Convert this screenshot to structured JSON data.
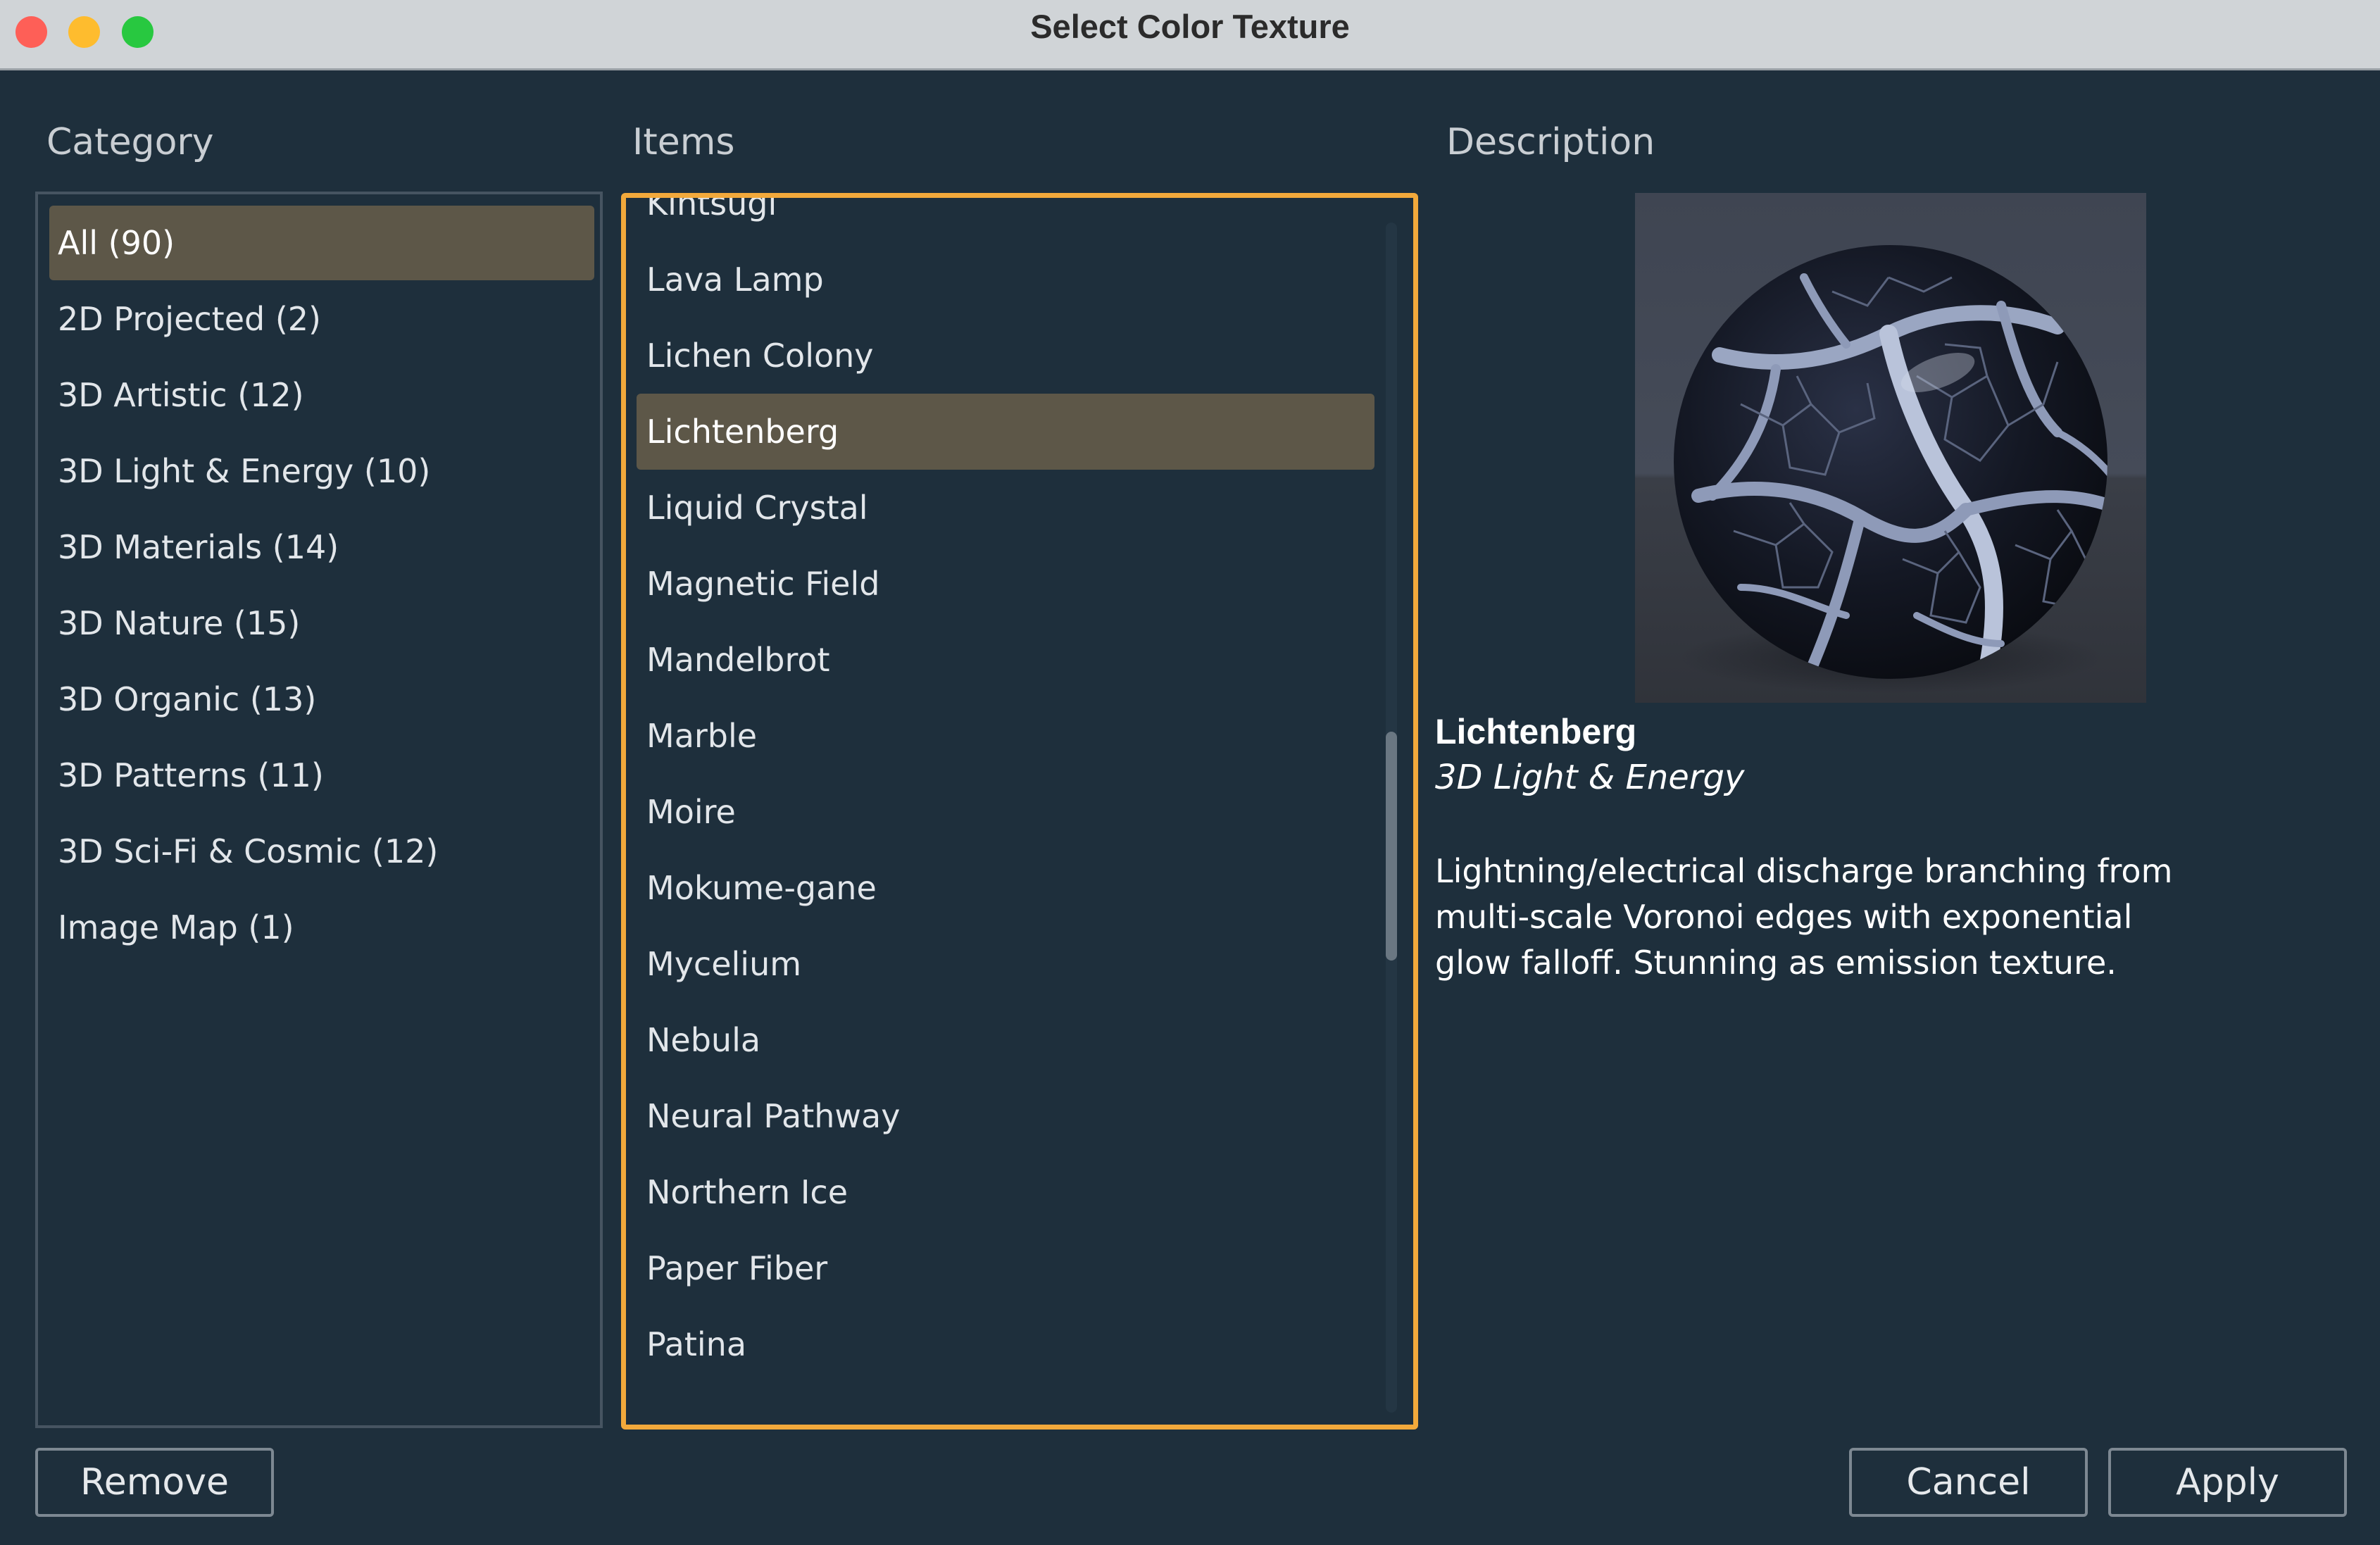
{
  "window": {
    "title": "Select Color Texture"
  },
  "headers": {
    "category": "Category",
    "items": "Items",
    "description": "Description"
  },
  "categories": [
    {
      "label": "All (90)",
      "selected": true
    },
    {
      "label": "2D Projected (2)"
    },
    {
      "label": "3D Artistic (12)"
    },
    {
      "label": "3D Light & Energy (10)"
    },
    {
      "label": "3D Materials (14)"
    },
    {
      "label": "3D Nature (15)"
    },
    {
      "label": "3D Organic (13)"
    },
    {
      "label": "3D Patterns (11)"
    },
    {
      "label": "3D Sci-Fi & Cosmic (12)"
    },
    {
      "label": "Image Map (1)"
    }
  ],
  "items": [
    {
      "label": "Kintsugi"
    },
    {
      "label": "Lava Lamp"
    },
    {
      "label": "Lichen Colony"
    },
    {
      "label": "Lichtenberg",
      "selected": true
    },
    {
      "label": "Liquid Crystal"
    },
    {
      "label": "Magnetic Field"
    },
    {
      "label": "Mandelbrot"
    },
    {
      "label": "Marble"
    },
    {
      "label": "Moire"
    },
    {
      "label": "Mokume-gane"
    },
    {
      "label": "Mycelium"
    },
    {
      "label": "Nebula"
    },
    {
      "label": "Neural Pathway"
    },
    {
      "label": "Northern Ice"
    },
    {
      "label": "Paper Fiber"
    },
    {
      "label": "Patina"
    }
  ],
  "description": {
    "name": "Lichtenberg",
    "category": "3D Light & Energy",
    "text": "Lightning/electrical discharge branching from multi-scale Voronoi edges with exponential glow falloff. Stunning as emission texture."
  },
  "buttons": {
    "remove": "Remove",
    "cancel": "Cancel",
    "apply": "Apply"
  },
  "colors": {
    "background": "#1e2f3c",
    "selection": "#5d5748",
    "focus_border": "#f2a93b"
  }
}
